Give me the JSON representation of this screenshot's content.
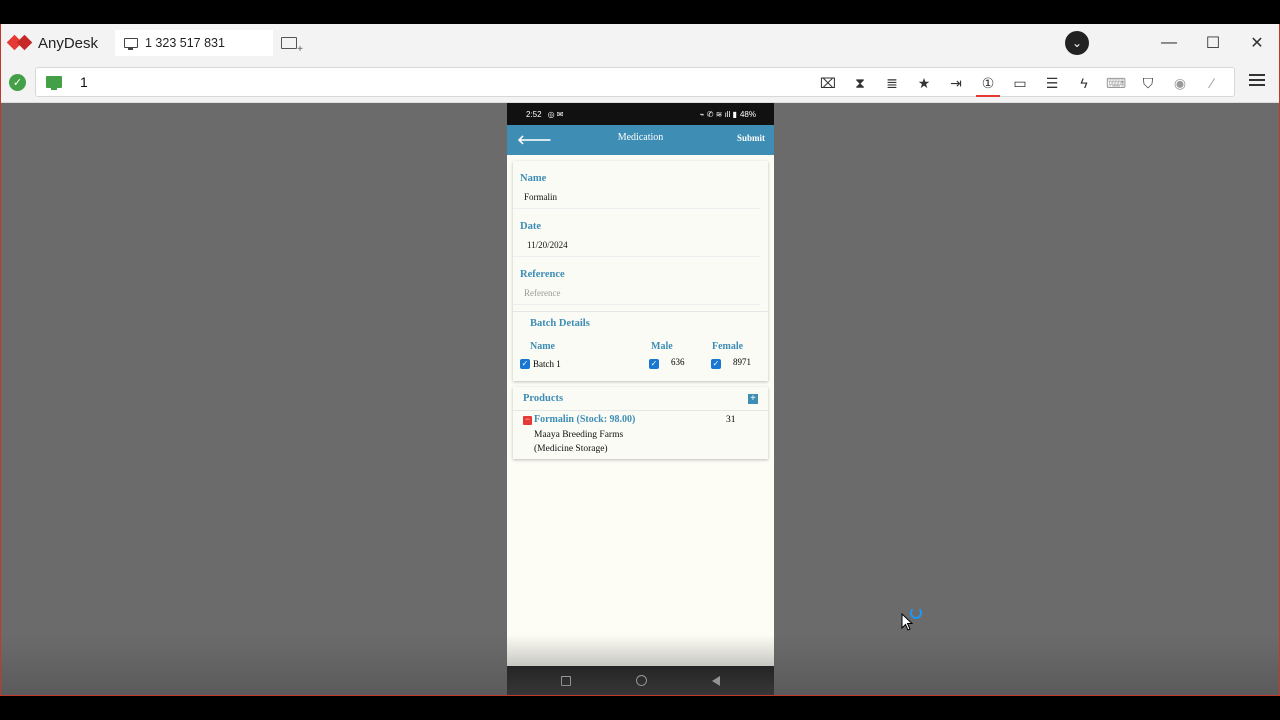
{
  "app": {
    "name": "AnyDesk",
    "tab_label": "1 323 517 831",
    "address_value": "1"
  },
  "status_bar": {
    "time": "2:52",
    "battery": "48%"
  },
  "appbar": {
    "title": "Medication",
    "submit_label": "Submit"
  },
  "form": {
    "name_label": "Name",
    "name_value": "Formalin",
    "date_label": "Date",
    "date_value": "11/20/2024",
    "reference_label": "Reference",
    "reference_placeholder": "Reference"
  },
  "batch": {
    "title": "Batch Details",
    "col_name": "Name",
    "col_male": "Male",
    "col_female": "Female",
    "rows": [
      {
        "name": "Batch 1",
        "male": "636",
        "female": "8971",
        "checked": true,
        "male_checked": true,
        "female_checked": true
      }
    ]
  },
  "products": {
    "title": "Products",
    "items": [
      {
        "name": "Formalin (Stock: 98.00)",
        "location": "Maaya Breeding Farms (Medicine Storage)",
        "qty": "31"
      }
    ]
  },
  "colors": {
    "accent": "#3d8db5",
    "brand": "#e53935",
    "checkbox": "#1976d2"
  }
}
